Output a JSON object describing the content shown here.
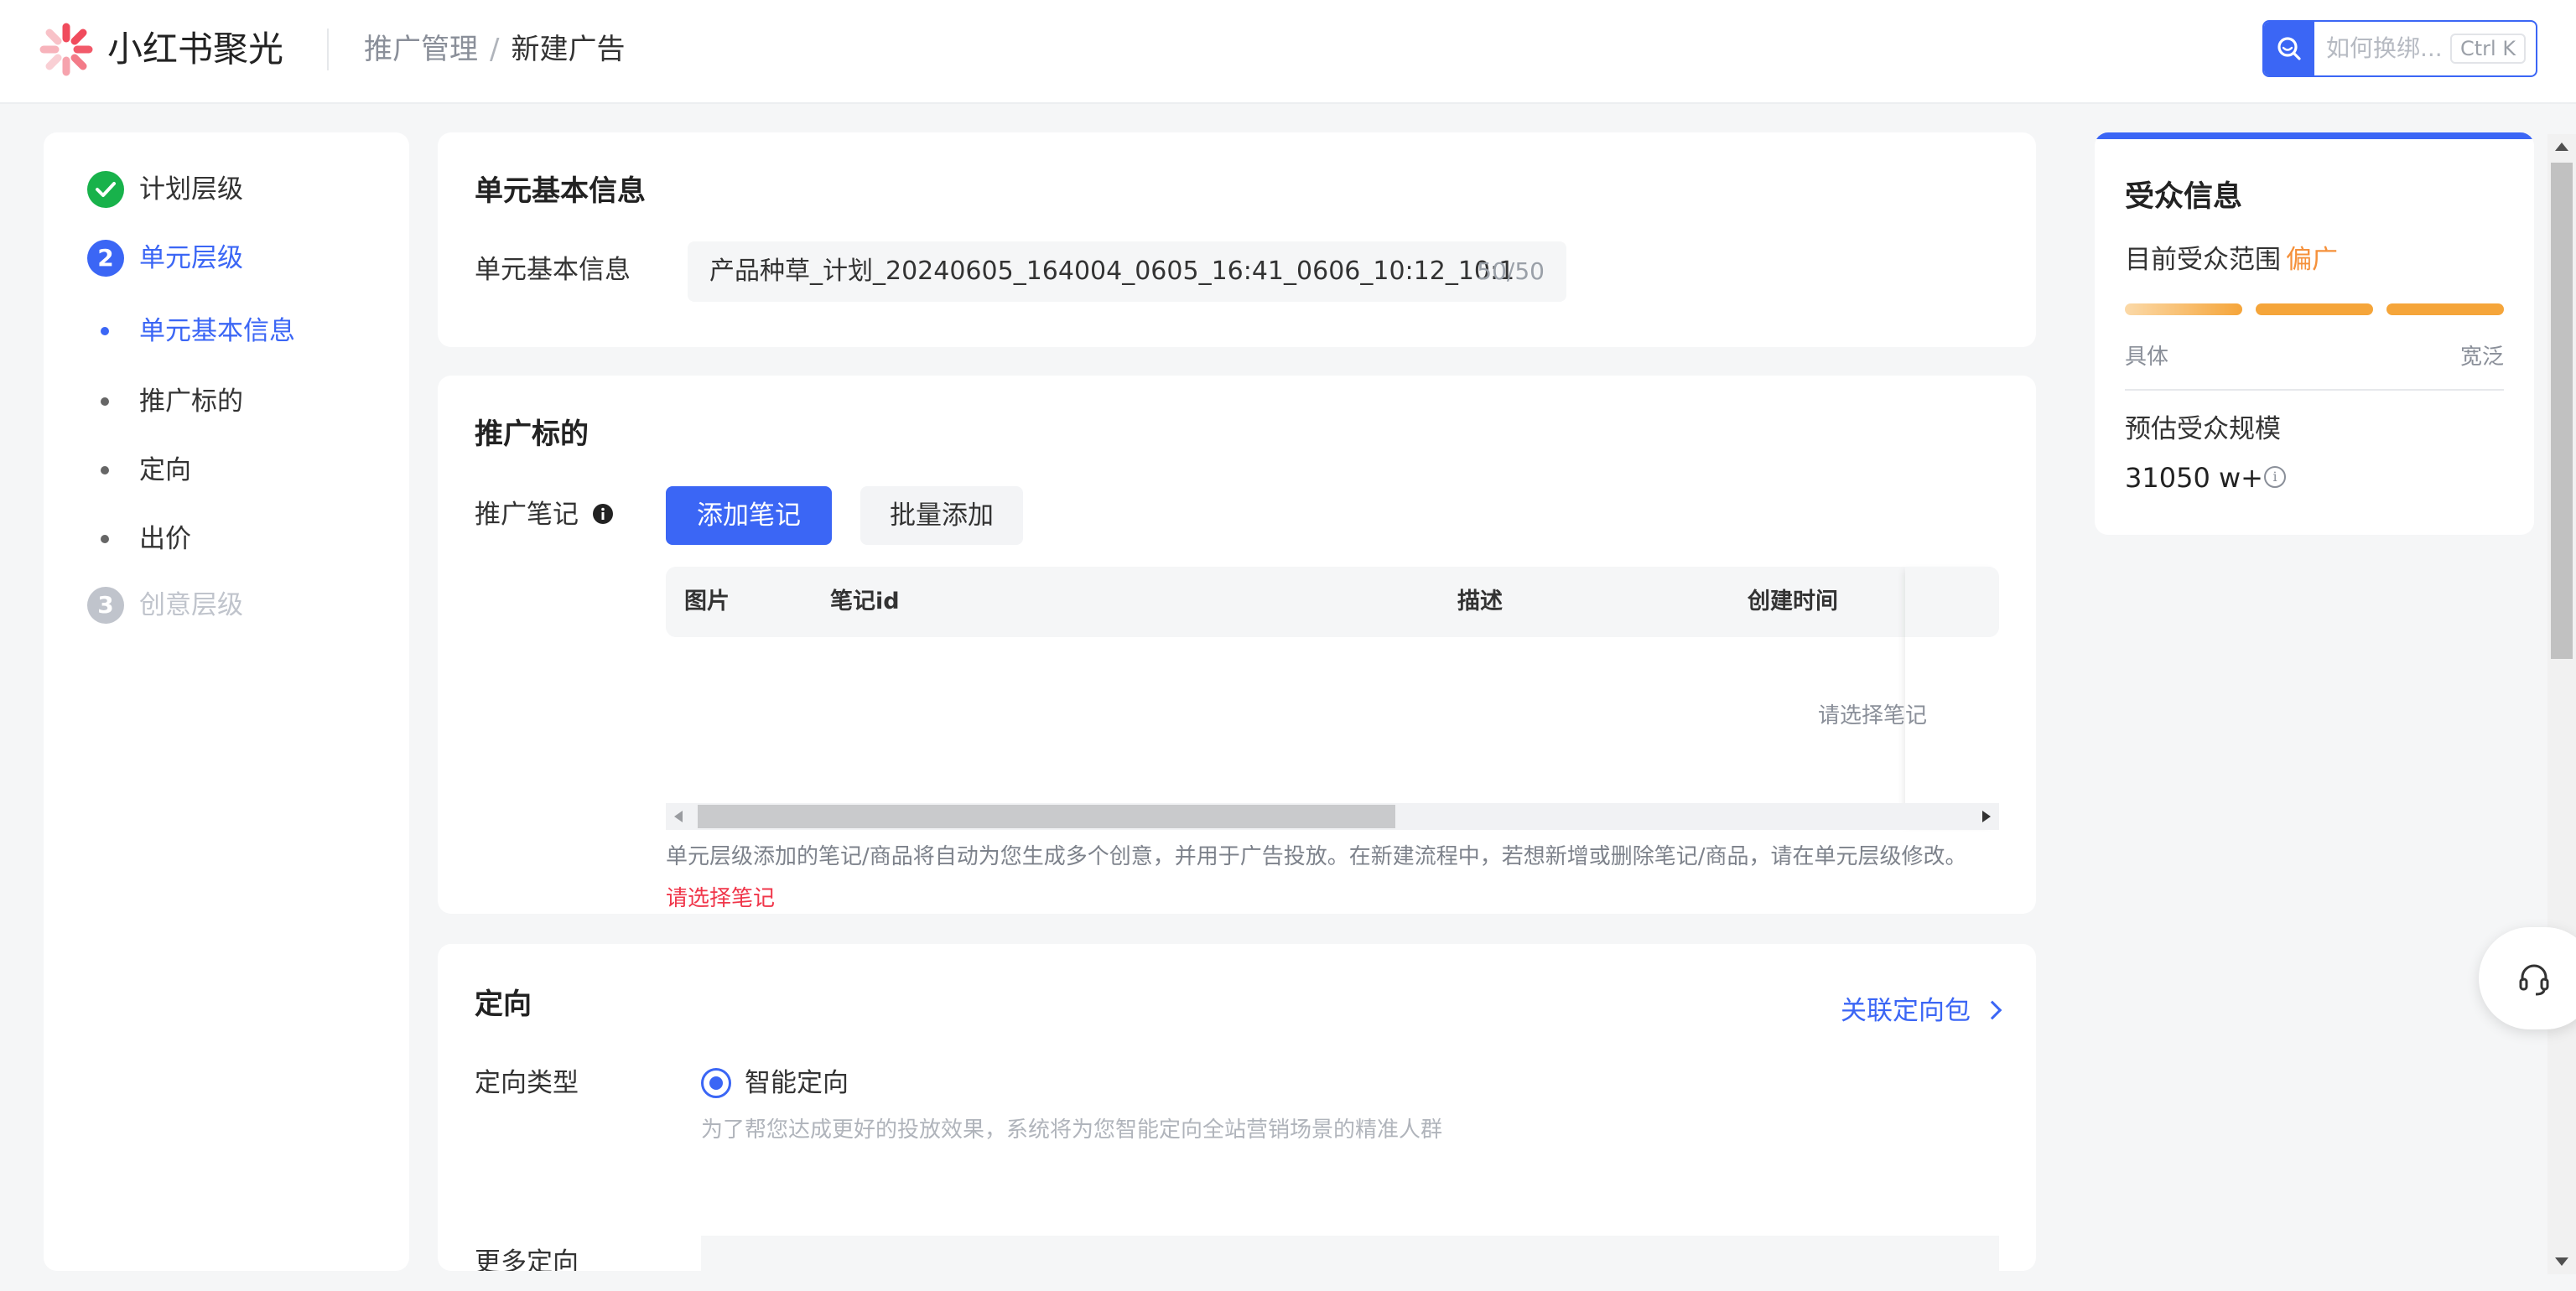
{
  "header": {
    "app_name": "小红书聚光",
    "breadcrumb": {
      "parent": "推广管理",
      "separator": "/",
      "current": "新建广告"
    },
    "search": {
      "placeholder": "如何换绑...",
      "shortcut": "Ctrl K"
    }
  },
  "colors": {
    "primary": "#3b66f5",
    "success": "#18b24b",
    "accent": "#f5913b",
    "error": "#f0364a",
    "disabled": "#c0c4cc"
  },
  "nav": {
    "steps": [
      {
        "label": "计划层级",
        "state": "done",
        "icon": "check-icon"
      },
      {
        "label": "单元层级",
        "number": "2",
        "state": "active"
      },
      {
        "label": "创意层级",
        "number": "3",
        "state": "pending"
      }
    ],
    "sub_items": [
      {
        "label": "单元基本信息",
        "active": true
      },
      {
        "label": "推广标的",
        "active": false
      },
      {
        "label": "定向",
        "active": false
      },
      {
        "label": "出价",
        "active": false
      }
    ]
  },
  "basic_info": {
    "title": "单元基本信息",
    "field_label": "单元基本信息",
    "name_value": "产品种草_计划_20240605_164004_0605_16:41_0606_10:12_10:1",
    "name_count": "50/50"
  },
  "promo_target": {
    "title": "推广标的",
    "field_label": "推广笔记",
    "add_button": "添加笔记",
    "batch_button": "批量添加",
    "columns": [
      "图片",
      "笔记id",
      "描述",
      "创建时间"
    ],
    "empty_text": "请选择笔记",
    "help_text": "单元层级添加的笔记/商品将自动为您生成多个创意，并用于广告投放。在新建流程中，若想新增或删除笔记/商品，请在单元层级修改。",
    "error_text": "请选择笔记"
  },
  "targeting": {
    "title": "定向",
    "link": "关联定向包",
    "type_label": "定向类型",
    "option_label": "智能定向",
    "option_desc": "为了帮您达成更好的投放效果，系统将为您智能定向全站营销场景的精准人群",
    "more_label": "更多定向"
  },
  "audience": {
    "title": "受众信息",
    "scope_label": "目前受众范围",
    "scope_value": "偏广",
    "scale_left": "具体",
    "scale_right": "宽泛",
    "estimate_label": "预估受众规模",
    "estimate_value": "31050 w+"
  }
}
